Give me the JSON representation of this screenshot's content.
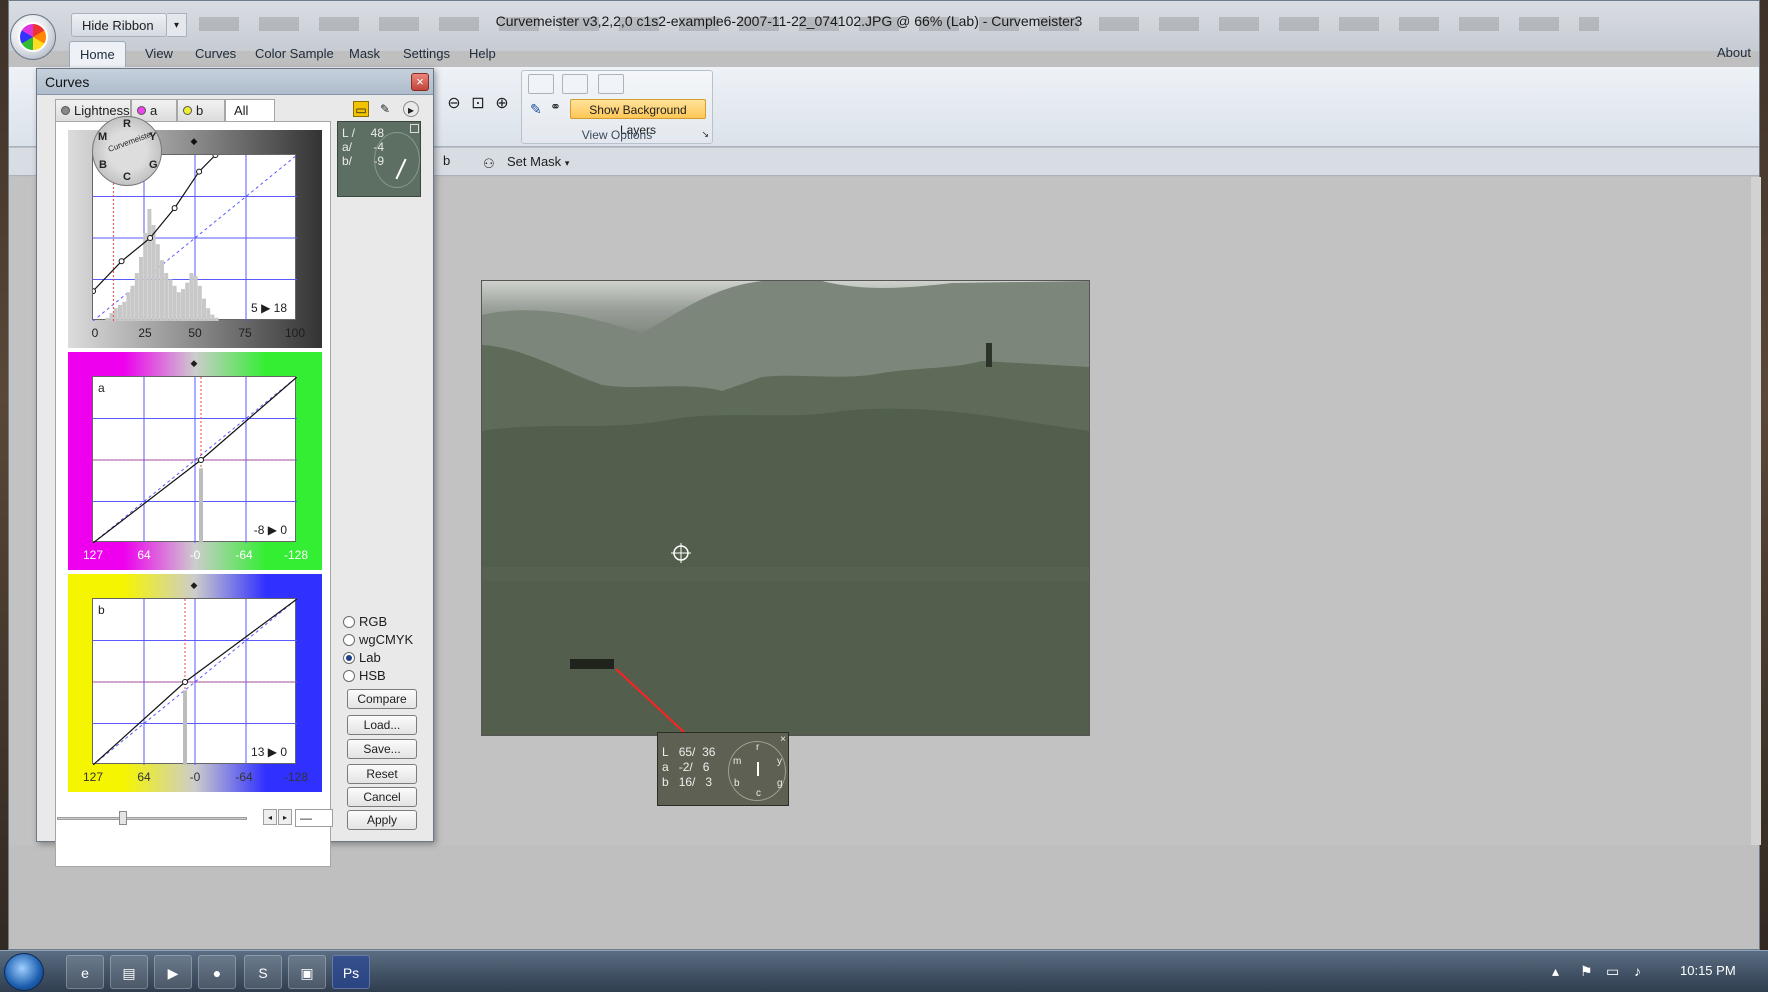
{
  "window": {
    "title": "Curvemeister v3,2,2,0      c1s2-example6-2007-11-22_074102.JPG @ 66% (Lab) - Curvemeister3",
    "hide_ribbon": "Hide Ribbon",
    "qa_chevron": "▾"
  },
  "ribbon": {
    "tabs": [
      {
        "label": "Home"
      },
      {
        "label": "View"
      },
      {
        "label": "Curves"
      },
      {
        "label": "Color Sample"
      },
      {
        "label": "Mask"
      },
      {
        "label": "Settings"
      },
      {
        "label": "Help"
      }
    ],
    "about": "About",
    "show_bg": "Show Background Layers",
    "view_options": "View Options"
  },
  "toolbar": {
    "b_label": "b",
    "set_mask": "Set Mask"
  },
  "curves": {
    "title": "Curves",
    "close": "×",
    "tabs": [
      {
        "label": "Lightness"
      },
      {
        "label": "a"
      },
      {
        "label": "b"
      },
      {
        "label": "All"
      }
    ],
    "lightness": {
      "axis": [
        "0",
        "25",
        "50",
        "75",
        "100"
      ],
      "readout_in": "5",
      "readout_out": "18",
      "curve": [
        [
          0,
          18
        ],
        [
          14,
          36
        ],
        [
          28,
          50
        ],
        [
          40,
          68
        ],
        [
          52,
          90
        ],
        [
          60,
          100
        ]
      ]
    },
    "a": {
      "name": "a",
      "axis": [
        "127",
        "64",
        "-0",
        "-64",
        "-128"
      ],
      "readout_in": "-8",
      "readout_out": "0"
    },
    "b": {
      "name": "b",
      "axis": [
        "127",
        "64",
        "-0",
        "-64",
        "-128"
      ],
      "readout_in": "13",
      "readout_out": "0"
    },
    "wheel_letters": [
      "R",
      "Y",
      "G",
      "C",
      "B",
      "M"
    ],
    "wheel_text": "Curvemeister",
    "readout": {
      "l_label": "L /",
      "l_val": "48",
      "a_label": "a/",
      "a_val": "-4",
      "b_label": "b/",
      "b_val": "-9"
    },
    "color_modes": [
      {
        "label": "RGB",
        "selected": false
      },
      {
        "label": "wgCMYK",
        "selected": false
      },
      {
        "label": "Lab",
        "selected": true
      },
      {
        "label": "HSB",
        "selected": false
      }
    ],
    "buttons": {
      "compare": "Compare",
      "load": "Load...",
      "save": "Save...",
      "reset": "Reset",
      "cancel": "Cancel",
      "apply": "Apply"
    },
    "slider_value": "—"
  },
  "sample": {
    "close": "×",
    "l_label": "L",
    "l_v1": "65/",
    "l_v2": "36",
    "a_label": "a",
    "a_v1": "-2/",
    "a_v2": "6",
    "b_label": "b",
    "b_v1": "16/",
    "b_v2": "3",
    "dial_letters": [
      "r",
      "y",
      "g",
      "c",
      "b",
      "m"
    ]
  },
  "taskbar": {
    "clock": "10:15 PM",
    "apps": [
      {
        "icon": "ie-icon",
        "glyph": "e"
      },
      {
        "icon": "explorer-icon",
        "glyph": "▤"
      },
      {
        "icon": "media-player-icon",
        "glyph": "▶"
      },
      {
        "icon": "firefox-icon",
        "glyph": "●"
      },
      {
        "icon": "skype-icon",
        "glyph": "S"
      },
      {
        "icon": "window-icon",
        "glyph": "▣"
      },
      {
        "icon": "photoshop-icon",
        "glyph": "Ps"
      }
    ]
  },
  "colors": {
    "accent": "#ffc757",
    "a_channel": [
      "#ee00ee",
      "#33ee33"
    ],
    "b_channel": [
      "#f5f500",
      "#3030ff"
    ]
  }
}
